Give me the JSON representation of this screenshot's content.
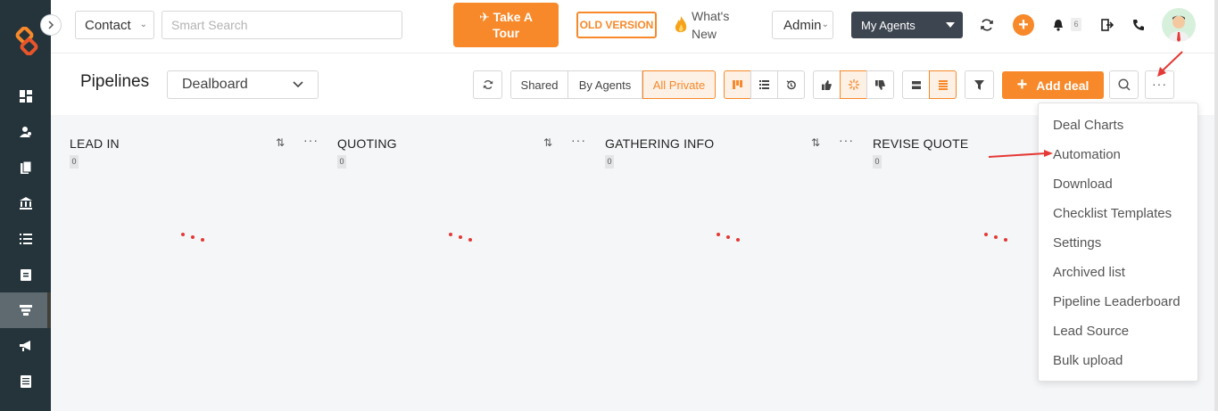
{
  "topbar": {
    "contact_select": "Contact",
    "search_placeholder": "Smart Search",
    "tour_line1": "Take A",
    "tour_line2": "Tour",
    "old_version": "OLD VERSION",
    "whats_new_line1": "What's",
    "whats_new_line2": "New",
    "admin_select": "Admin",
    "agents_select": "My Agents",
    "notification_count": "6"
  },
  "toolbar": {
    "title": "Pipelines",
    "pipeline_select": "Dealboard",
    "shared": "Shared",
    "by_agents": "By Agents",
    "all_private": "All Private",
    "add_deal": "Add deal"
  },
  "columns": [
    {
      "title": "LEAD IN",
      "count": "0"
    },
    {
      "title": "QUOTING",
      "count": "0"
    },
    {
      "title": "GATHERING INFO",
      "count": "0"
    },
    {
      "title": "REVISE QUOTE",
      "count": "0"
    }
  ],
  "more_menu": {
    "items": [
      "Deal Charts",
      "Automation",
      "Download",
      "Checklist Templates",
      "Settings",
      "Archived list",
      "Pipeline Leaderboard",
      "Lead Source",
      "Bulk upload"
    ]
  },
  "colors": {
    "accent": "#f7892a",
    "sidebar": "#25343b",
    "annotation_arrow": "#e53935"
  },
  "icons": [
    "logo-icon",
    "dashboard-icon",
    "contacts-icon",
    "documents-icon",
    "bank-icon",
    "list-icon",
    "clipboard-icon",
    "pipeline-icon",
    "megaphone-icon",
    "notes-icon",
    "refresh-icon",
    "plus-icon",
    "bell-icon",
    "logout-icon",
    "phone-icon",
    "search-icon",
    "filter-icon",
    "more-icon"
  ]
}
